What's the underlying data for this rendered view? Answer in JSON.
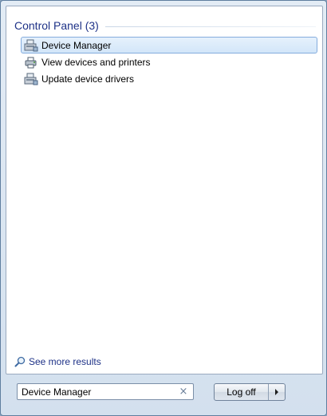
{
  "results": {
    "group_title": "Control Panel (3)",
    "items": [
      {
        "label": "Device Manager",
        "icon": "device-manager-icon",
        "selected": true
      },
      {
        "label": "View devices and printers",
        "icon": "devices-printers-icon",
        "selected": false
      },
      {
        "label": "Update device drivers",
        "icon": "device-drivers-icon",
        "selected": false
      }
    ],
    "see_more_label": "See more results"
  },
  "search": {
    "value": "Device Manager",
    "clear_glyph": "×"
  },
  "power": {
    "logoff_label": "Log off"
  },
  "colors": {
    "group_title": "#1e3287",
    "selection_border": "#84acdd",
    "selection_fill": "#d3e6f9"
  }
}
